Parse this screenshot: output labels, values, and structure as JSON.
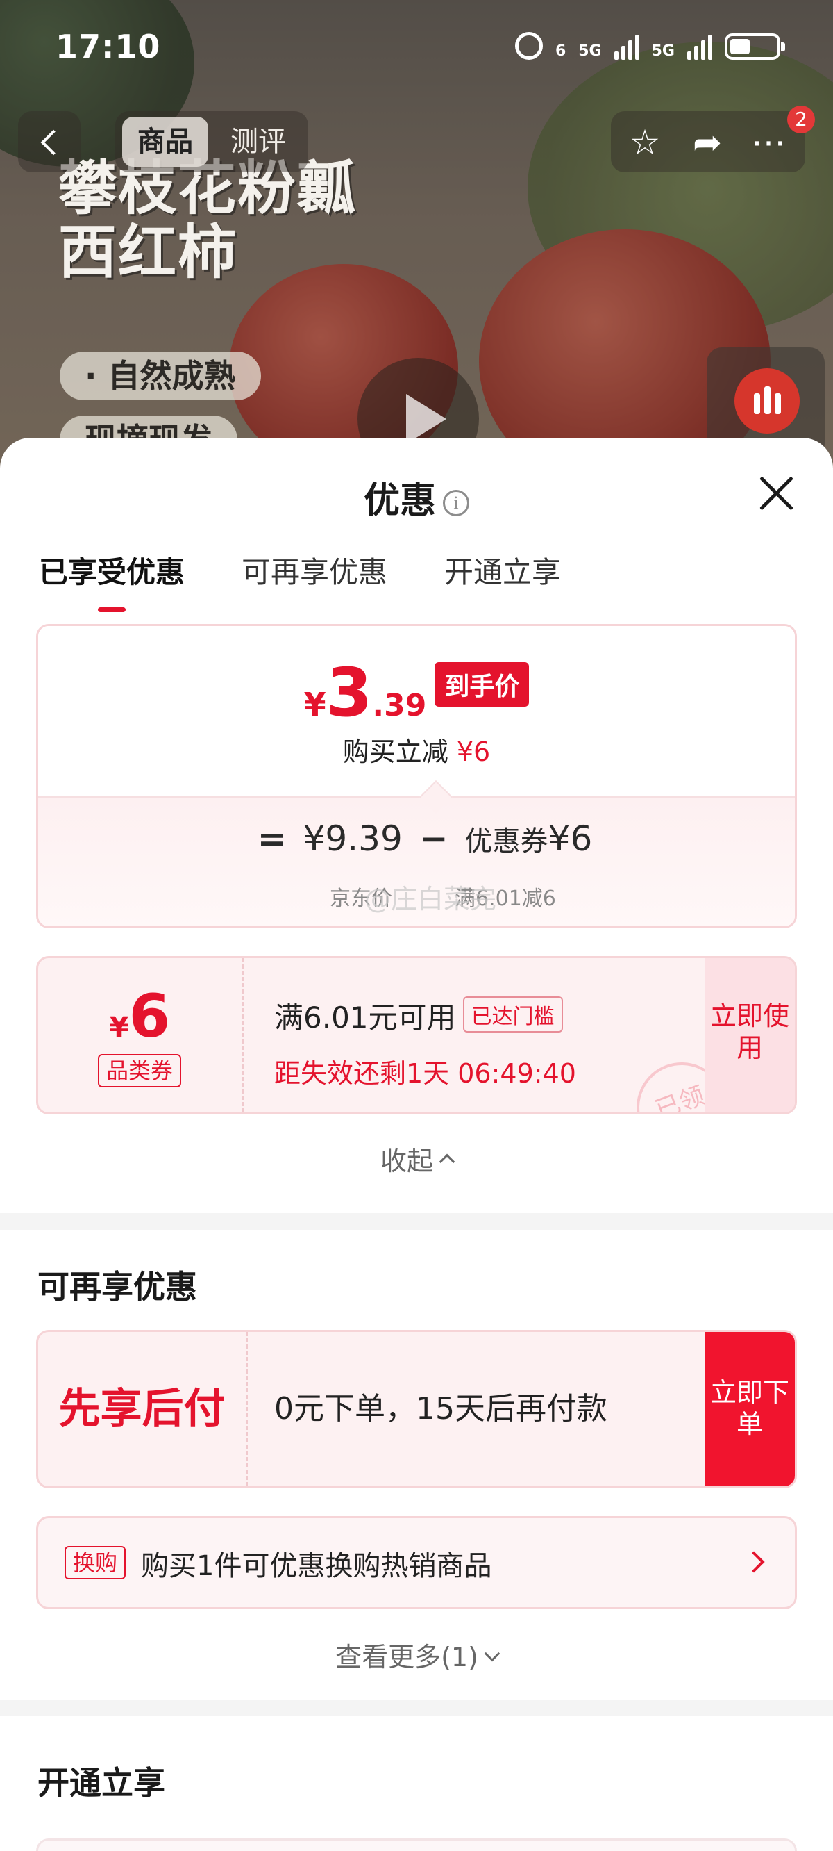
{
  "status_bar": {
    "time": "17:10",
    "net1": "5G",
    "net2": "5G",
    "wifi_label": "6"
  },
  "hero": {
    "title_line1": "攀枝花粉瓤",
    "title_line2": "西红柿",
    "chip1": "· 自然成熟",
    "chip2": "现摘现发"
  },
  "nav": {
    "tabs": [
      {
        "label": "商品"
      },
      {
        "label": "测评"
      }
    ],
    "badge": "2"
  },
  "sheet": {
    "title": "优惠",
    "tabs": [
      {
        "label": "已享受优惠"
      },
      {
        "label": "可再享优惠"
      },
      {
        "label": "开通立享"
      }
    ]
  },
  "price_card": {
    "currency": "¥",
    "price_int": "3",
    "price_dec": ".39",
    "final_tag": "到手价",
    "instant_label": "购买立减",
    "instant_amount": "¥6",
    "equals": "=",
    "jd_price": "¥9.39",
    "minus": "−",
    "coupon_label": "优惠券",
    "coupon_amount": "¥6",
    "jd_price_label": "京东价",
    "coupon_rule": "满6.01减6",
    "watermark": "@庄白菜完"
  },
  "coupon": {
    "currency": "¥",
    "amount": "6",
    "type": "品类券",
    "condition": "满6.01元可用",
    "reach_tag": "已达门槛",
    "expire": "距失效还剩1天 06:49:40",
    "action": "立即使用",
    "stamp": "已领"
  },
  "collapse_label": "收起",
  "section2": {
    "title": "可再享优惠",
    "bnpl": {
      "title": "先享后付",
      "desc": "0元下单，15天后再付款",
      "action": "立即下单"
    },
    "swap": {
      "tag": "换购",
      "text": "购买1件可优惠换购热销商品"
    },
    "more_label": "查看更多(1)"
  },
  "section3": {
    "title": "开通立享"
  },
  "colors": {
    "accent": "#e4132d",
    "card_bg": "#fdf1f2",
    "card_border": "#f6d4d7"
  }
}
